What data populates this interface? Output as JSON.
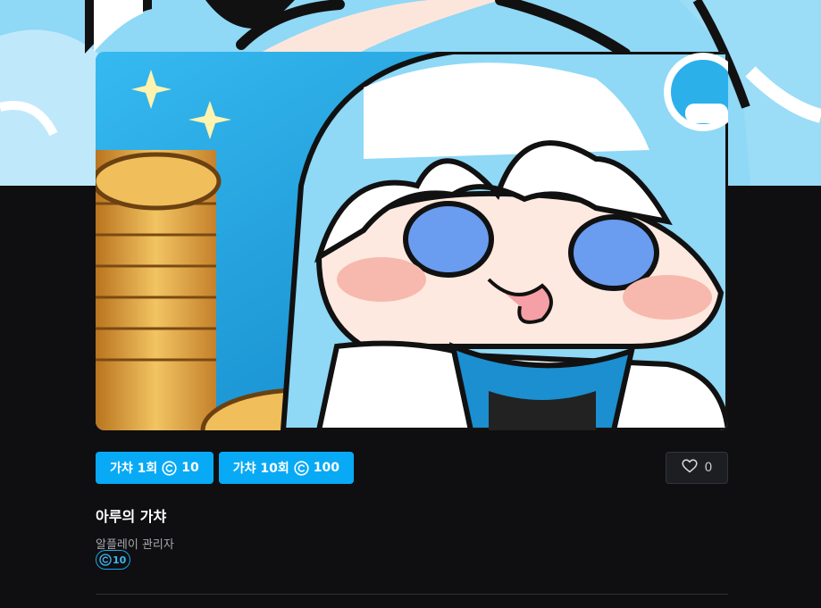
{
  "gacha": {
    "title": "아루의 가챠",
    "author": "알플레이 관리자",
    "price": "10",
    "likes": "0"
  },
  "actions": {
    "single_label": "가챠 1회",
    "single_cost": "10",
    "ten_label": "가챠 10회",
    "ten_cost": "100"
  },
  "icons": {
    "coin": "copyright-coin-icon",
    "like": "heart-icon"
  },
  "colors": {
    "accent": "#08aaf5",
    "background": "#0f0f11",
    "text_primary": "#ffffff",
    "text_secondary": "#a8a8ae"
  }
}
